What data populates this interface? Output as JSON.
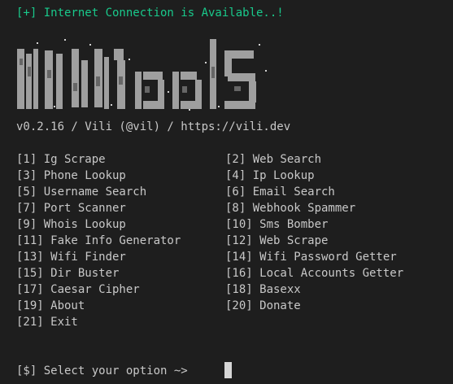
{
  "status_line": "[+] Internet Connection is Available..!",
  "banner": {
    "text": "ViliTools",
    "colors": {
      "light": "#a9a9a9",
      "dark": "#6f6f6f",
      "speck": "#d0d0d0"
    }
  },
  "version_line": "v0.2.16 / Vili (@vil) / https://vili.dev",
  "menu": [
    "[1] Ig Scrape",
    "[2] Web Search",
    "[3] Phone Lookup",
    "[4] Ip Lookup",
    "[5] Username Search",
    "[6] Email Search",
    "[7] Port Scanner",
    "[8] Webhook Spammer",
    "[9] Whois Lookup",
    "[10] Sms Bomber",
    "[11] Fake Info Generator",
    "[12] Web Scrape",
    "[13] Wifi Finder",
    "[14] Wifi Password Getter",
    "[15] Dir Buster",
    "[16] Local Accounts Getter",
    "[17] Caesar Cipher",
    "[18] Basexx",
    "[19] About",
    "[20] Donate",
    "[21] Exit"
  ],
  "prompt": "[$] Select your option ~>",
  "colors": {
    "background": "#1e1e1e",
    "text": "#c8c8c8",
    "status": "#19c98b"
  }
}
